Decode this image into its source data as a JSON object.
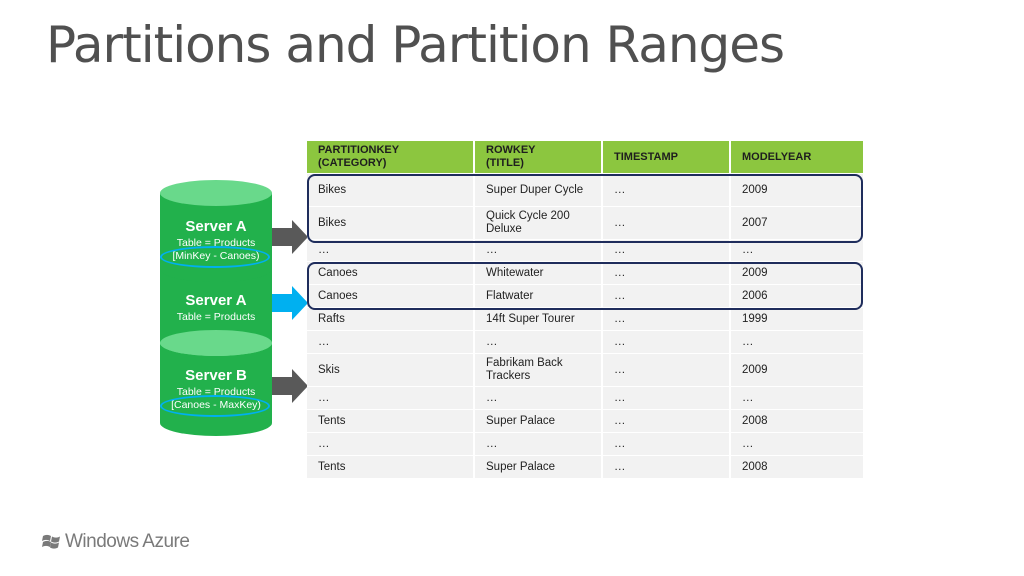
{
  "slide": {
    "title": "Partitions and Partition Ranges"
  },
  "table": {
    "headers": [
      [
        "PARTITIONKEY",
        "(CATEGORY)"
      ],
      [
        "ROWKEY",
        "(TITLE)"
      ],
      [
        "TIMESTAMP"
      ],
      [
        "MODELYEAR"
      ]
    ],
    "rows": [
      [
        "Bikes",
        "Super Duper Cycle",
        "…",
        "2009"
      ],
      [
        "Bikes",
        "Quick Cycle 200 Deluxe",
        "…",
        "2007"
      ],
      [
        "…",
        "…",
        "…",
        "…"
      ],
      [
        "Canoes",
        "Whitewater",
        "…",
        "2009"
      ],
      [
        "Canoes",
        "Flatwater",
        "…",
        "2006"
      ],
      [
        "Rafts",
        "14ft Super Tourer",
        "…",
        "1999"
      ],
      [
        "…",
        "…",
        "…",
        "…"
      ],
      [
        "Skis",
        "Fabrikam Back Trackers",
        "…",
        "2009"
      ],
      [
        "…",
        "…",
        "…",
        "…"
      ],
      [
        "Tents",
        "Super Palace",
        "…",
        "2008"
      ],
      [
        "…",
        "…",
        "…",
        "…"
      ],
      [
        "Tents",
        "Super Palace",
        "…",
        "2008"
      ]
    ]
  },
  "servers": [
    {
      "name": "Server A",
      "line1": "Table = Products",
      "line2": "[MinKey - Canoes)"
    },
    {
      "name": "Server A",
      "line1": "Table = Products"
    },
    {
      "name": "Server B",
      "line1": "Table = Products",
      "line2": "[Canoes - MaxKey)"
    }
  ],
  "colors": {
    "header_green": "#8cc63f",
    "server_green": "#22b14c",
    "server_top": "#69d98b",
    "highlight_navy": "#1f2d5c",
    "range_blue": "#00b0f0",
    "arrow_gray": "#595959",
    "arrow_blue": "#00b0f0"
  },
  "branding": {
    "logo_text": "Windows Azure",
    "logo_icon": "windows-flag-icon"
  }
}
